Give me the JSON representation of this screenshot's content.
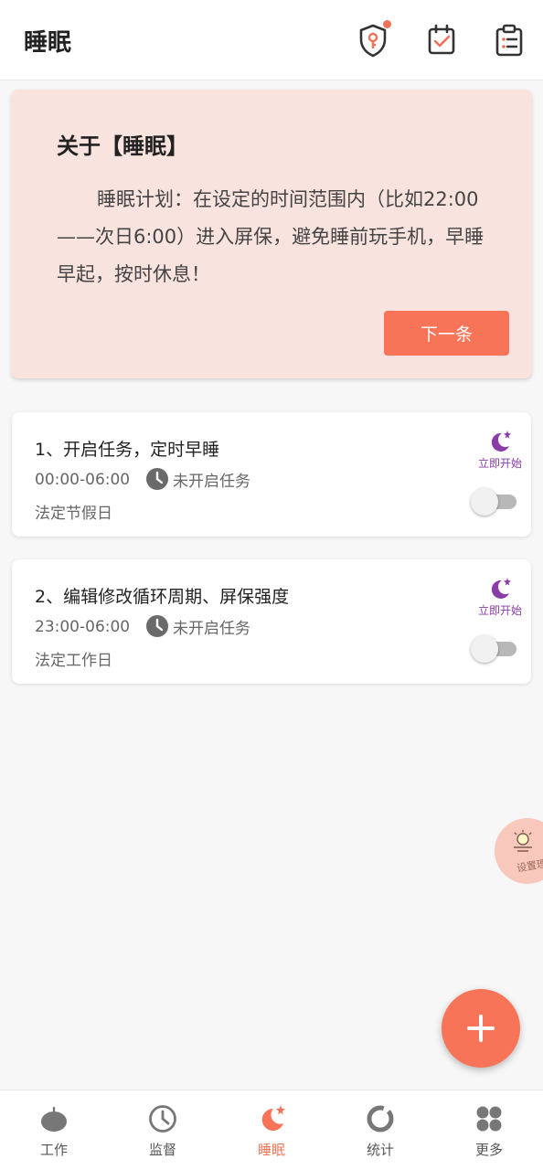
{
  "header": {
    "title": "睡眠",
    "icons": [
      "shield-key-icon",
      "calendar-check-icon",
      "clipboard-list-icon"
    ]
  },
  "info_card": {
    "title": "关于【睡眠】",
    "body": "睡眠计划：在设定的时间范围内（比如22:00——次日6:00）进入屏保，避免睡前玩手机，早睡早起，按时休息！",
    "next_label": "下一条"
  },
  "tasks": [
    {
      "name": "1、开启任务，定时早睡",
      "time": "00:00-06:00",
      "status": "未开启任务",
      "day_type": "法定节假日",
      "start_now": "立即开始",
      "enabled": false
    },
    {
      "name": "2、编辑修改循环周期、屏保强度",
      "time": "23:00-06:00",
      "status": "未开启任务",
      "day_type": "法定工作日",
      "start_now": "立即开始",
      "enabled": false
    }
  ],
  "float_settings": {
    "label": "设置理"
  },
  "nav": {
    "items": [
      {
        "label": "工作",
        "icon": "tomato-icon"
      },
      {
        "label": "监督",
        "icon": "clock-icon"
      },
      {
        "label": "睡眠",
        "icon": "moon-star-icon",
        "active": true
      },
      {
        "label": "统计",
        "icon": "donut-chart-icon"
      },
      {
        "label": "更多",
        "icon": "grid-icon"
      }
    ]
  },
  "colors": {
    "accent": "#f87458",
    "card_bg": "#f9e3df",
    "purple": "#8a3ca8",
    "grey_icon": "#777777"
  }
}
